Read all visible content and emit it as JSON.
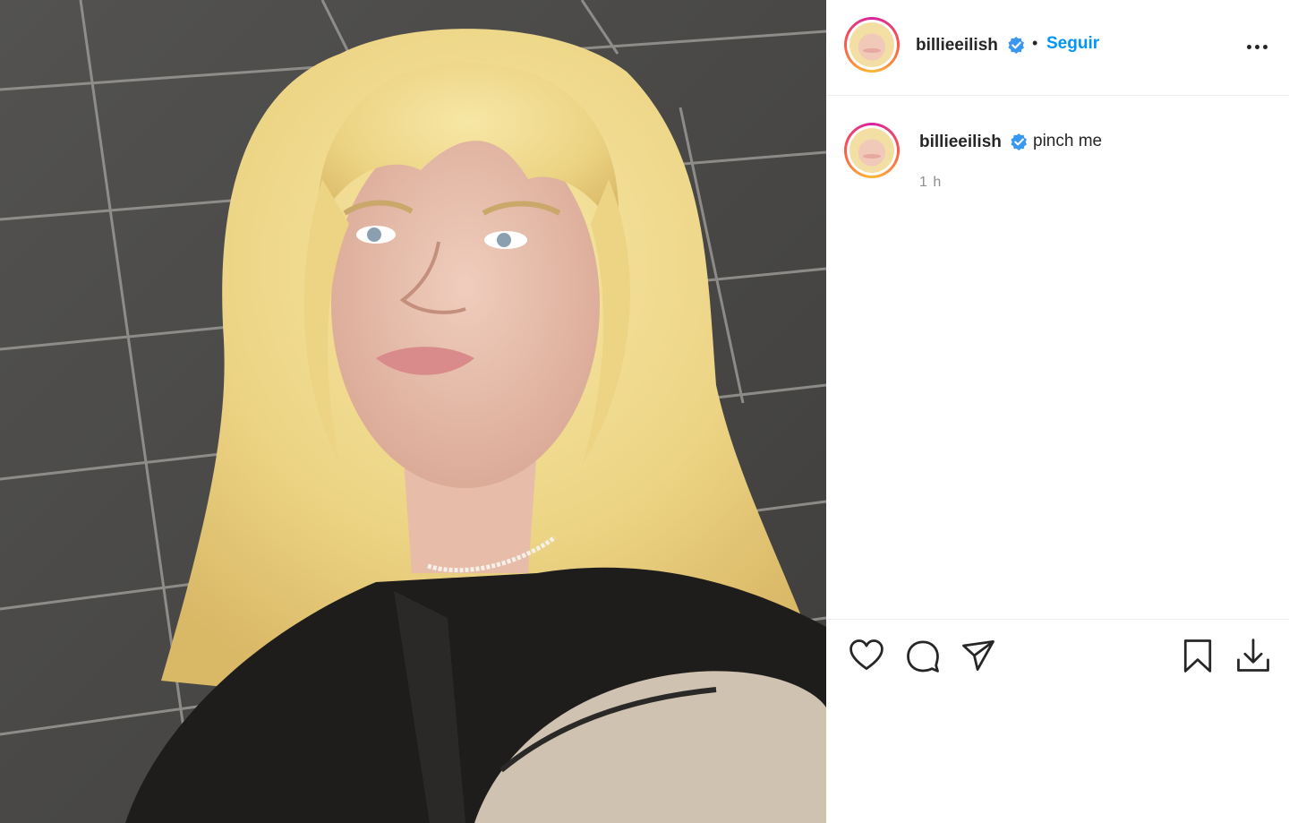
{
  "post": {
    "image_alt": "Retrato de persona con cabello rubio frente a una pared de azulejos grises",
    "author": {
      "username": "billieeilish",
      "verified": true
    },
    "header": {
      "separator": "•",
      "follow_label": "Seguir"
    },
    "comment": {
      "username": "billieeilish",
      "text": "pinch me",
      "time": "1 h"
    },
    "actions": {
      "icons": [
        "heart-icon",
        "comment-icon",
        "share-icon",
        "bookmark-icon",
        "download-icon"
      ]
    }
  },
  "colors": {
    "accent": "#0095f6",
    "text": "#262626",
    "muted": "#8e8e8e",
    "verified": "#3897f0",
    "divider": "#efefef"
  }
}
